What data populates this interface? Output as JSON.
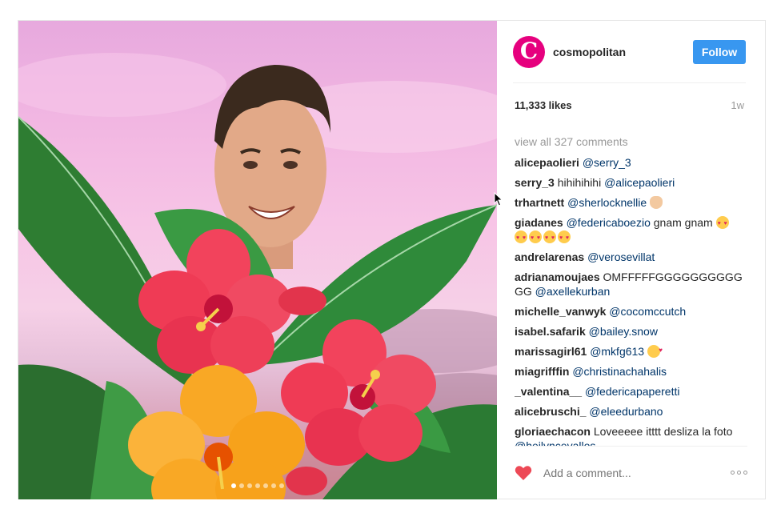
{
  "post": {
    "username": "cosmopolitan",
    "avatar_letter": "C",
    "follow_label": "Follow",
    "likes": "11,333 likes",
    "time": "1w",
    "view_all": "view all 327 comments",
    "carousel": {
      "count": 7,
      "active": 0
    },
    "comments": [
      {
        "user": "alicepaolieri",
        "parts": [
          {
            "t": "mention",
            "v": "@serry_3"
          }
        ]
      },
      {
        "user": "serry_3",
        "parts": [
          {
            "t": "text",
            "v": "hihihihihi "
          },
          {
            "t": "mention",
            "v": "@alicepaolieri"
          }
        ]
      },
      {
        "user": "trhartnett",
        "parts": [
          {
            "t": "mention",
            "v": "@sherlocknellie "
          },
          {
            "t": "emoji",
            "v": "hand"
          }
        ]
      },
      {
        "user": "giadanes",
        "parts": [
          {
            "t": "mention",
            "v": "@federicaboezio"
          },
          {
            "t": "text",
            "v": " gnam gnam "
          },
          {
            "t": "emoji",
            "v": "heart-eyes"
          },
          {
            "t": "br",
            "v": ""
          },
          {
            "t": "emoji",
            "v": "heart-eyes"
          },
          {
            "t": "emoji",
            "v": "heart-eyes"
          },
          {
            "t": "emoji",
            "v": "heart-eyes"
          },
          {
            "t": "emoji",
            "v": "heart-eyes"
          }
        ]
      },
      {
        "user": "andrelarenas",
        "parts": [
          {
            "t": "mention",
            "v": "@verosevillat"
          }
        ]
      },
      {
        "user": "adrianamoujaes",
        "parts": [
          {
            "t": "text",
            "v": "OMFFFFFGGGGGGGGGG GG "
          },
          {
            "t": "mention",
            "v": "@axellekurban"
          }
        ]
      },
      {
        "user": "michelle_vanwyk",
        "parts": [
          {
            "t": "mention",
            "v": "@cocomccutch"
          }
        ]
      },
      {
        "user": "isabel.safarik",
        "parts": [
          {
            "t": "mention",
            "v": "@bailey.snow"
          }
        ]
      },
      {
        "user": "marissagirl61",
        "parts": [
          {
            "t": "mention",
            "v": "@mkfg613 "
          },
          {
            "t": "emoji",
            "v": "kiss"
          }
        ]
      },
      {
        "user": "miagrifffin",
        "parts": [
          {
            "t": "mention",
            "v": "@christinachahalis"
          }
        ]
      },
      {
        "user": "_valentina__",
        "parts": [
          {
            "t": "mention",
            "v": "@federicapaperetti"
          }
        ]
      },
      {
        "user": "alicebruschi_",
        "parts": [
          {
            "t": "mention",
            "v": "@eleedurbano"
          }
        ]
      },
      {
        "user": "gloriaechacon",
        "parts": [
          {
            "t": "text",
            "v": "Loveeeee itttt desliza la foto "
          },
          {
            "t": "mention",
            "v": "@heilyncevallos"
          }
        ]
      }
    ],
    "comment_placeholder": "Add a comment...",
    "colors": {
      "accent": "#3897f0",
      "brand": "#e6007e",
      "like": "#ed4956",
      "mention": "#003569"
    },
    "icons": [
      "cosmopolitan-avatar",
      "heart-icon",
      "more-options-icon",
      "cursor-icon"
    ]
  }
}
